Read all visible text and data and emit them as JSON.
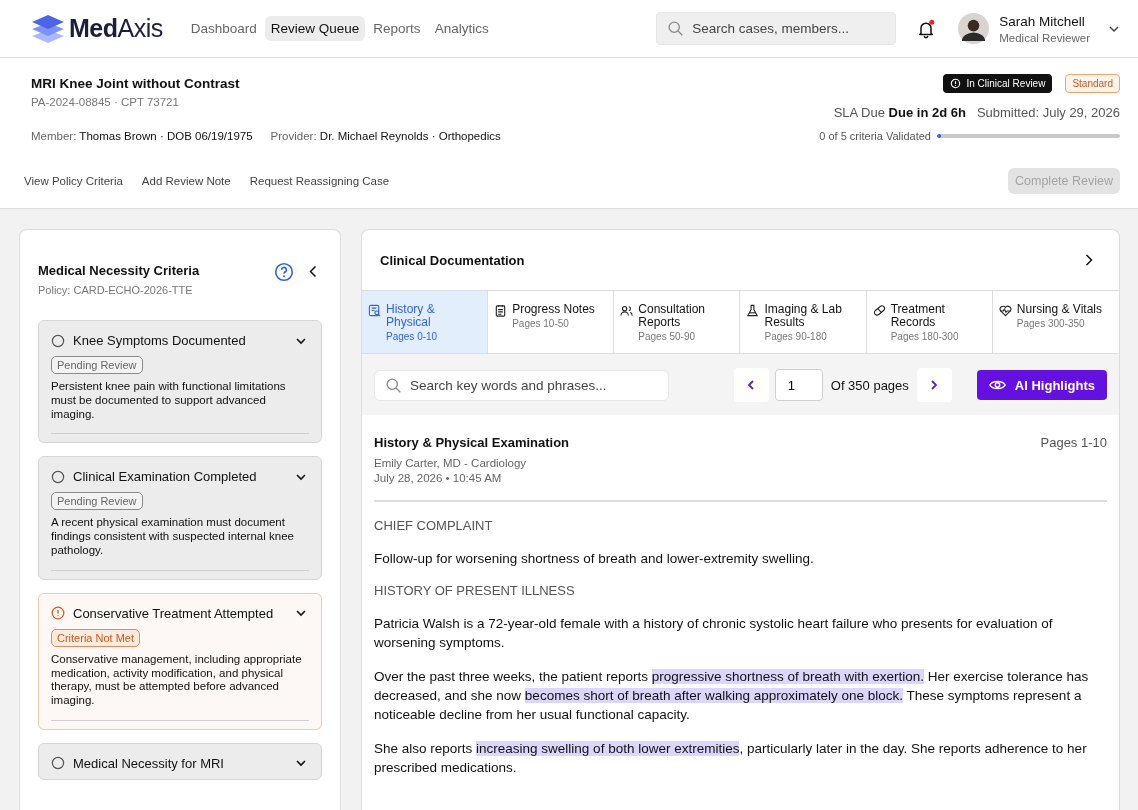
{
  "brand": {
    "name_bold": "Med",
    "name_light": "Axis"
  },
  "nav": [
    {
      "label": "Dashboard",
      "selected": false
    },
    {
      "label": "Review Queue",
      "selected": true
    },
    {
      "label": "Reports",
      "selected": false
    },
    {
      "label": "Analytics",
      "selected": false
    }
  ],
  "search": {
    "placeholder": "Search cases, members..."
  },
  "notifications": {
    "unread": true
  },
  "user": {
    "name": "Sarah Mitchell",
    "role": "Medical Reviewer"
  },
  "case": {
    "title": "MRI Knee Joint without Contrast",
    "reference": "PA-2024-08845 · CPT 73721",
    "status_badge": "In Clinical Review",
    "priority_badge": "Standard",
    "sla_label": "SLA Due",
    "sla_value": "Due in 2d 6h",
    "submitted_label": "Submitted:",
    "submitted_value": "July 29, 2026",
    "member_label": "Member:",
    "member_value": "Thomas Brown · DOB 06/19/1975",
    "provider_label": "Provider:",
    "provider_value": "Dr. Michael Reynolds · Orthopedics",
    "progress_text": "0 of 5 criteria Validated",
    "level": 0.02
  },
  "actions": [
    {
      "label": "View Policy Criteria"
    },
    {
      "label": "Add Review Note"
    },
    {
      "label": "Request Reassigning Case"
    }
  ],
  "complete_button": {
    "label": "Complete Review",
    "disabled": true
  },
  "criteria_panel": {
    "title": "Medical Necessity Criteria",
    "policy": "Policy: CARD-ECHO-2026-TTE",
    "items": [
      {
        "title": "Knee Symptoms Documented",
        "kind": "pending",
        "badge": "Pending Review",
        "description": "Persistent knee pain with functional limitations must be documented to support advanced imaging."
      },
      {
        "title": "Clinical Examination Completed",
        "kind": "pending",
        "badge": "Pending Review",
        "description": "A recent physical examination must document findings consistent with suspected internal knee pathology."
      },
      {
        "title": "Conservative Treatment Attempted",
        "kind": "unmet",
        "badge": "Criteria Not Met",
        "description": "Conservative management, including appropriate medication, activity modification, and physical therapy, must be attempted before advanced imaging."
      },
      {
        "title": "Medical Necessity for MRI",
        "kind": "pending"
      }
    ]
  },
  "documentation": {
    "title": "Clinical Documentation",
    "tabs": [
      {
        "kind": "history",
        "label": "History & Physical",
        "pages": "Pages 0-10",
        "selected": true
      },
      {
        "kind": "notes",
        "label": "Progress Notes",
        "pages": "Pages 10-50",
        "selected": false
      },
      {
        "kind": "consult",
        "label": "Consultation Reports",
        "pages": "Pages 50-90",
        "selected": false
      },
      {
        "kind": "lab",
        "label": "Imaging & Lab Results",
        "pages": "Pages 90-180",
        "selected": false
      },
      {
        "kind": "treatment",
        "label": "Treatment Records",
        "pages": "Pages 180-300",
        "selected": false
      },
      {
        "kind": "vitals",
        "label": "Nursing & Vitals",
        "pages": "Pages 300-350",
        "selected": false
      }
    ],
    "search": {
      "placeholder": "Search key words and phrases..."
    },
    "page": {
      "value": "1",
      "total": "Of 350 pages"
    },
    "ai_button": {
      "label": "AI Highlights"
    },
    "document": {
      "title": "History & Physical Examination",
      "pages": "Pages 1-10",
      "author": "Emily Carter, MD - Cardiology",
      "date": "July 28, 2026 • 10:45 AM",
      "blocks": [
        {
          "kind": "heading",
          "text": "CHIEF COMPLAINT"
        },
        {
          "kind": "paragraph",
          "segments": [
            {
              "text": "Follow-up for worsening shortness of breath and lower-extremity swelling.",
              "highlight": false
            }
          ]
        },
        {
          "kind": "heading",
          "text": "HISTORY OF PRESENT ILLNESS"
        },
        {
          "kind": "paragraph",
          "segments": [
            {
              "text": "Patricia Walsh is a 72-year-old female with a history of chronic systolic heart failure who presents for evaluation of worsening symptoms.",
              "highlight": false
            }
          ]
        },
        {
          "kind": "paragraph",
          "segments": [
            {
              "text": "Over the past three weeks, the patient reports ",
              "highlight": false
            },
            {
              "text": "progressive shortness of breath with exertion.",
              "highlight": true
            },
            {
              "text": " Her exercise tolerance has decreased, and she now ",
              "highlight": false
            },
            {
              "text": "becomes short of breath after walking approximately one block.",
              "highlight": true
            },
            {
              "text": " These symptoms represent a noticeable decline from her usual functional capacity.",
              "highlight": false
            }
          ]
        },
        {
          "kind": "paragraph",
          "segments": [
            {
              "text": "She also reports ",
              "highlight": false
            },
            {
              "text": "increasing swelling of both lower extremities",
              "highlight": true
            },
            {
              "text": ", particularly later in the day. She reports adherence to her prescribed medications.",
              "highlight": false
            }
          ]
        }
      ]
    }
  }
}
